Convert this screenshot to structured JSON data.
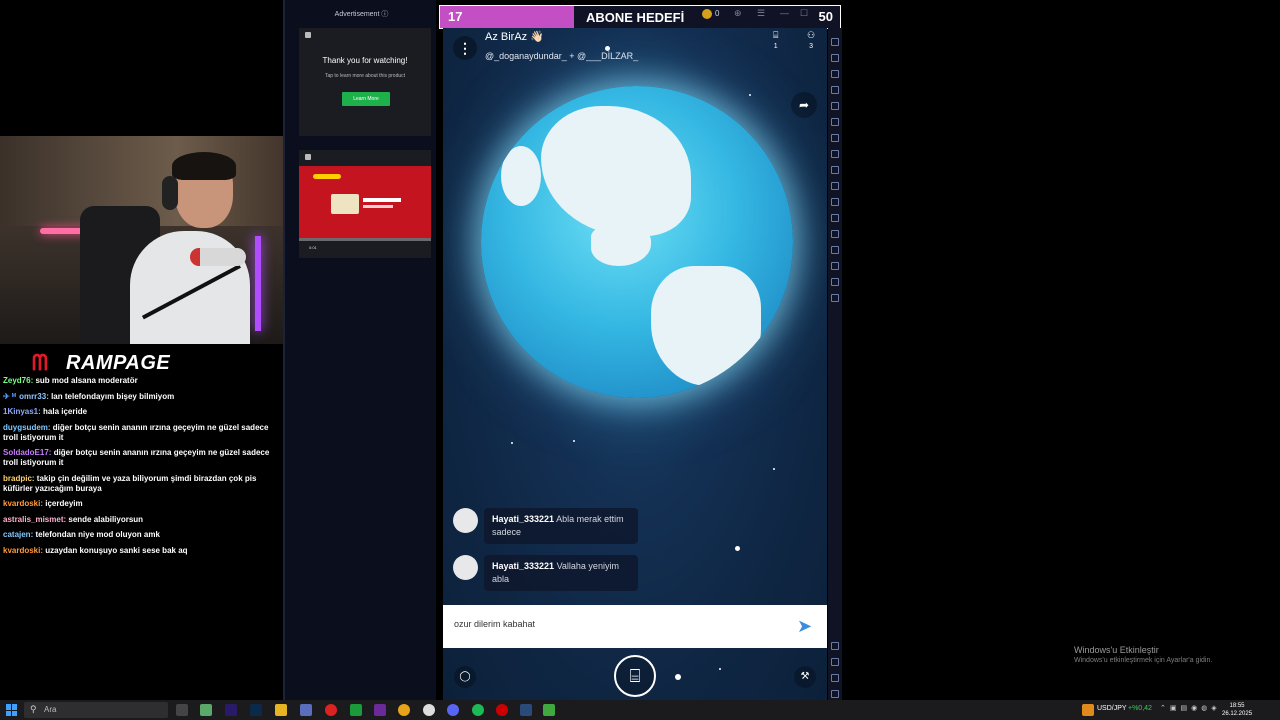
{
  "ad_column": {
    "label": "Advertisement ⓘ",
    "ad1": {
      "title": "Thank you for watching!",
      "subtitle": "Tap to learn more about this product",
      "button": "Learn More"
    },
    "ad2": {
      "time": "0:01"
    }
  },
  "stream_overlay": {
    "logo_text": "RAMPAGE",
    "goal_bar": {
      "current": "17",
      "label": "ABONE HEDEFİ",
      "coins": "0",
      "target": "50"
    }
  },
  "chat": [
    {
      "user": "Zeyd76",
      "color": "#7cff8a",
      "text": "sub mod alsana moderatör",
      "icon": ""
    },
    {
      "user": "omrr33",
      "color": "#8fc8ff",
      "text": "lan telefondayım bişey bilmiyom",
      "icon": "✈ ᴹ"
    },
    {
      "user": "1Kinyas1",
      "color": "#8fa8ff",
      "text": "hala içeride",
      "icon": ""
    },
    {
      "user": "duygsudem",
      "color": "#7fc9ff",
      "text": "diğer botçu senin ananın ırzına geçeyim ne güzel sadece troll istiyorum it",
      "icon": ""
    },
    {
      "user": "SoldadoE17",
      "color": "#c57bff",
      "text": "diğer botçu senin ananın ırzına geçeyim ne güzel sadece troll istiyorum it",
      "icon": ""
    },
    {
      "user": "bradpic",
      "color": "#ffd36a",
      "text": "takip çin değilim ve yaza biliyorum şimdi birazdan çok pis küfürler yazıcağım buraya",
      "icon": ""
    },
    {
      "user": "kvardoski",
      "color": "#ff9b3c",
      "text": "içerdeyim",
      "icon": ""
    },
    {
      "user": "astralis_mismet",
      "color": "#ffb0d0",
      "text": "sende alabiliyorsun",
      "icon": ""
    },
    {
      "user": "catajen",
      "color": "#7fc9ff",
      "text": "telefondan niye mod oluyon amk",
      "icon": ""
    },
    {
      "user": "kvardoski",
      "color": "#ff9b3c",
      "text": "uzaydan konuşuyo sanki sese bak aq",
      "icon": ""
    }
  ],
  "app": {
    "room_title": "Az BirAz 👋🏻",
    "room_users": "@_doganaydundar_ + @___DİLZAR_",
    "gift_count": "1",
    "user_count": "3",
    "messages": [
      {
        "user": "Hayati_333221",
        "text": "Abla merak ettim sadece"
      },
      {
        "user": "Hayati_333221",
        "text": "Vallaha yeniyim abla"
      }
    ],
    "input_value": "ozur dilerim kabahat"
  },
  "windows": {
    "activate_title": "Windows'u Etkinleştir",
    "activate_sub": "Windows'u etkinleştirmek için Ayarlar'a gidin.",
    "search_placeholder": "Ara",
    "fx_pair": "USD/JPY",
    "fx_change": "+%0,42",
    "time": "18:55",
    "date": "26.12.2025"
  },
  "colors": {
    "accent_pink": "#c44fc4",
    "send_blue": "#3c8de0",
    "ad_green": "#1eb04a",
    "ad_red": "#c31420"
  }
}
